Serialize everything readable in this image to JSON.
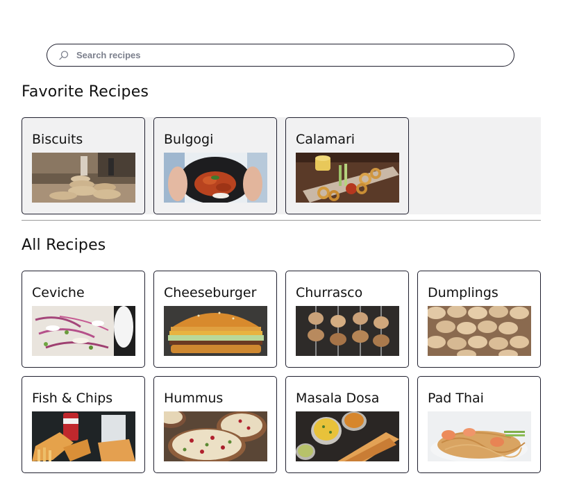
{
  "search": {
    "placeholder": "Search recipes",
    "value": ""
  },
  "sections": {
    "favorites_title": "Favorite Recipes",
    "all_title": "All Recipes"
  },
  "favorites": [
    {
      "name": "Biscuits"
    },
    {
      "name": "Bulgogi"
    },
    {
      "name": "Calamari"
    }
  ],
  "all_recipes": [
    {
      "name": "Ceviche"
    },
    {
      "name": "Cheeseburger"
    },
    {
      "name": "Churrasco"
    },
    {
      "name": "Dumplings"
    },
    {
      "name": "Fish & Chips"
    },
    {
      "name": "Hummus"
    },
    {
      "name": "Masala Dosa"
    },
    {
      "name": "Pad Thai"
    }
  ],
  "colors": {
    "border": "#1f1f2e",
    "favorites_background": "#f1f1f2",
    "divider": "#9a9a9a",
    "placeholder": "#7b7f8c"
  }
}
